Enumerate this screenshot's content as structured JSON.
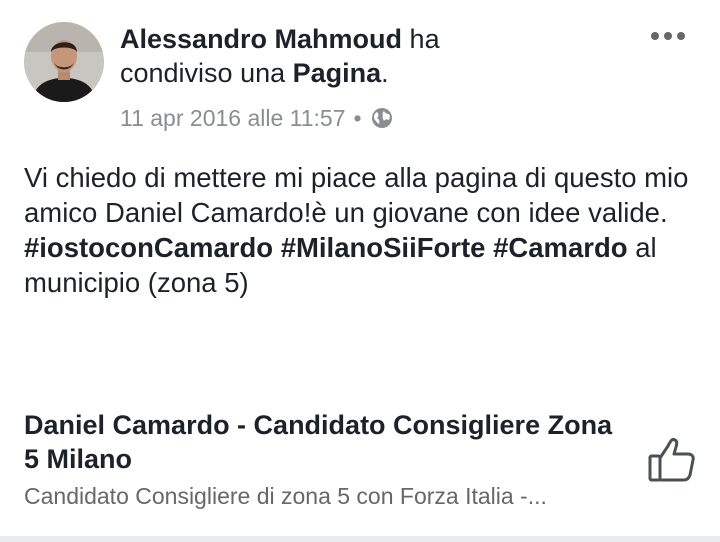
{
  "post": {
    "author": "Alessandro Mahmoud",
    "action_pre": " ha",
    "action_line2_pre": "condiviso una ",
    "action_target": "Pagina",
    "action_end": ".",
    "timestamp": "11 apr 2016 alle 11:57",
    "separator": "•",
    "privacy_icon": "globe-icon",
    "more_icon": "more-options-icon",
    "message": {
      "text_1": "Vi chiedo di mettere mi piace alla pagina di questo mio amico Daniel Camardo!è un giovane con idee valide. ",
      "hashtag_1": "#iostoconCamardo",
      "space_1": " ",
      "hashtag_2": "#MilanoSiiForte",
      "space_2": " ",
      "hashtag_3": "#Camardo",
      "text_2": " al municipio (zona 5)"
    },
    "shared_page": {
      "title": "Daniel Camardo - Candidato Consigliere Zona 5 Milano",
      "description": "Candidato Consigliere di zona 5 con Forza Italia -...",
      "like_icon": "thumbs-up-icon"
    }
  }
}
